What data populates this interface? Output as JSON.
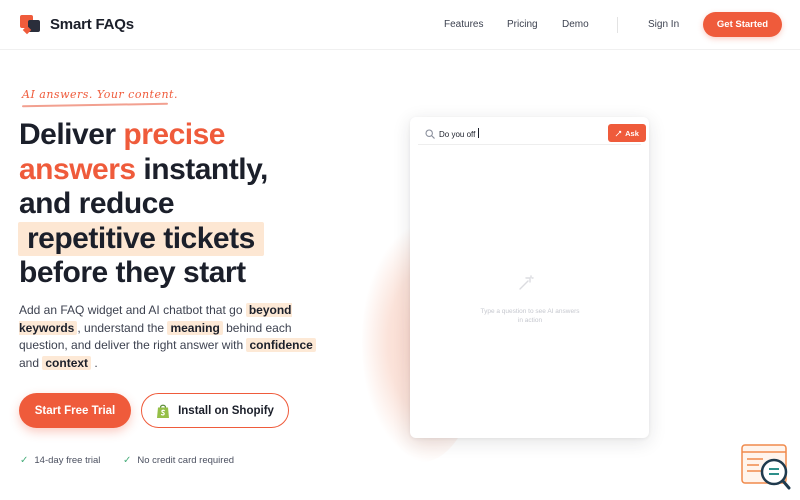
{
  "brand": {
    "name": "Smart FAQs"
  },
  "nav": {
    "links": [
      "Features",
      "Pricing",
      "Demo"
    ],
    "sign_in": "Sign In",
    "get_started": "Get Started"
  },
  "hero": {
    "tagline": "AI answers. Your content.",
    "headline": {
      "line1_a": "Deliver ",
      "line1_b": "precise",
      "line2_a": "answers",
      "line2_b": " instantly,",
      "line3": "and reduce",
      "line4": "repetitive tickets",
      "line5": "before they start"
    },
    "description": {
      "p1": "Add an FAQ widget and AI chatbot that go",
      "kw1": "beyond keywords",
      "p2": ", understand the",
      "kw2": "meaning",
      "p3": " behind each question, and deliver the right answer with",
      "kw3": "confidence",
      "p4": " and ",
      "kw4": "context",
      "p5": " ."
    },
    "cta_primary": "Start Free Trial",
    "cta_secondary": "Install on Shopify",
    "checks": [
      "14-day free trial",
      "No credit card required"
    ]
  },
  "widget": {
    "search_value": "Do you off",
    "ask_label": "Ask",
    "empty_text": "Type a question to see AI answers in action"
  },
  "colors": {
    "accent": "#ef5b3b",
    "highlight": "#fde7d3",
    "text": "#1b1f2a",
    "check": "#4caf7d"
  }
}
